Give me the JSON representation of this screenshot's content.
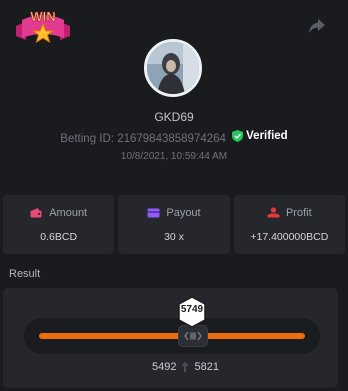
{
  "badge": {
    "text": "WIN",
    "icon": "win-badge-icon"
  },
  "header": {
    "share_icon": "share-icon"
  },
  "user": {
    "avatar_icon": "avatar-photo",
    "name": "GKD69",
    "betting_id_label": "Betting ID:",
    "betting_id": "21679843858974264",
    "verified_label": "Verified",
    "timestamp": "10/8/2021, 10:59:44 AM"
  },
  "stats": [
    {
      "label": "Amount",
      "value": "0.6BCD",
      "icon": "wallet-icon",
      "color": "#e94b74"
    },
    {
      "label": "Payout",
      "value": "30 x",
      "icon": "card-icon",
      "color": "#8e5cf4"
    },
    {
      "label": "Profit",
      "value": "+17.400000BCD",
      "icon": "profit-icon",
      "color": "#e43a3a"
    }
  ],
  "result": {
    "label": "Result",
    "value": "5749",
    "range_low": "5492",
    "range_high": "5821"
  },
  "colors": {
    "background": "#1a1b1f",
    "card": "#25272c",
    "accent": "#ec6d0a",
    "verified": "#22c55e"
  }
}
